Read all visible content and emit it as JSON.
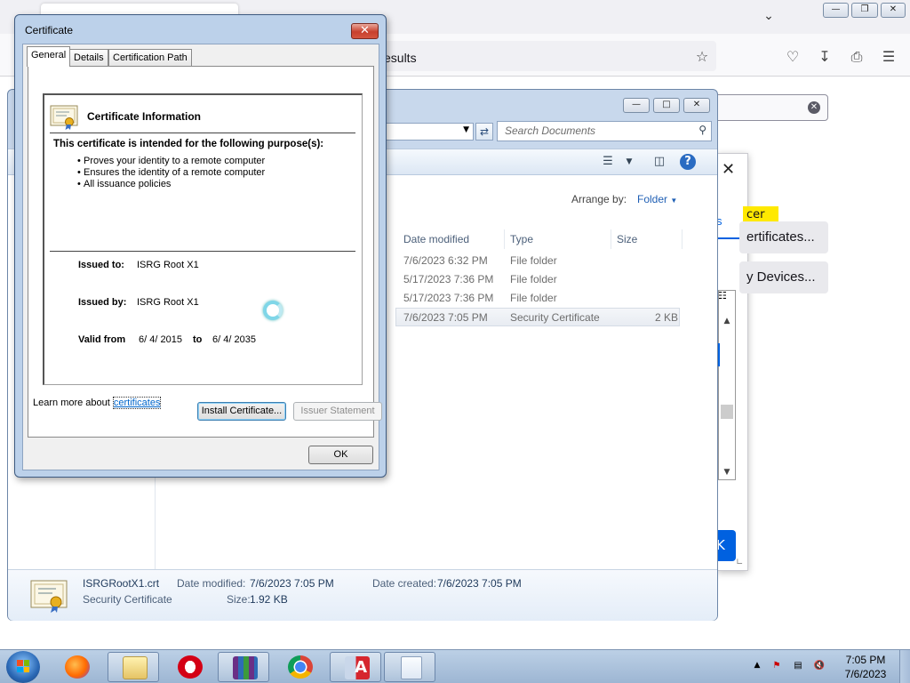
{
  "firefox": {
    "url_fragment": "esults",
    "cert_manager": {
      "tab_fragment": "s",
      "badge_fragment": "cer",
      "button1_fragment": "ertificates...",
      "button2_fragment": "y Devices...",
      "list_header_icon": "column-picker-icon",
      "ok_fragment": "K"
    }
  },
  "explorer": {
    "search_placeholder": "Search Documents",
    "arrange_label": "Arrange by:",
    "arrange_value": "Folder",
    "columns": [
      "Date modified",
      "Type",
      "Size"
    ],
    "rows": [
      {
        "date": "7/6/2023 6:32 PM",
        "type": "File folder",
        "size": ""
      },
      {
        "date": "5/17/2023 7:36 PM",
        "type": "File folder",
        "size": ""
      },
      {
        "date": "5/17/2023 7:36 PM",
        "type": "File folder",
        "size": ""
      },
      {
        "date": "7/6/2023 7:05 PM",
        "type": "Security Certificate",
        "size": "2 KB",
        "selected": true
      }
    ],
    "details": {
      "name": "ISRGRootX1.crt",
      "type": "Security Certificate",
      "modified_label": "Date modified:",
      "modified_value": "7/6/2023 7:05 PM",
      "size_label": "Size:",
      "size_value": "1.92 KB",
      "created_label": "Date created:",
      "created_value": "7/6/2023 7:05 PM"
    }
  },
  "certificate": {
    "title": "Certificate",
    "tabs": [
      "General",
      "Details",
      "Certification Path"
    ],
    "active_tab": "General",
    "info_heading": "Certificate Information",
    "purpose_heading": "This certificate is intended for the following purpose(s):",
    "purposes": [
      "Proves your identity to a remote computer",
      "Ensures the identity of a remote computer",
      "All issuance policies"
    ],
    "issued_to_label": "Issued to:",
    "issued_to": "ISRG Root X1",
    "issued_by_label": "Issued by:",
    "issued_by": "ISRG Root X1",
    "valid_from_label": "Valid from",
    "valid_from": "6/ 4/ 2015",
    "valid_to_label": "to",
    "valid_to": "6/ 4/ 2035",
    "install_button": "Install Certificate...",
    "issuer_button": "Issuer Statement",
    "learn_prefix": "Learn more about ",
    "learn_link": "certificates",
    "ok_button": "OK"
  },
  "taskbar": {
    "apps": [
      "firefox",
      "explorer",
      "opera",
      "winrar",
      "chrome",
      "acrobat",
      "notepad"
    ],
    "time": "7:05 PM",
    "date": "7/6/2023"
  },
  "colors": {
    "link": "#0066cc",
    "firefox_accent": "#0061e0",
    "titlebar": "#bcd1ea"
  }
}
